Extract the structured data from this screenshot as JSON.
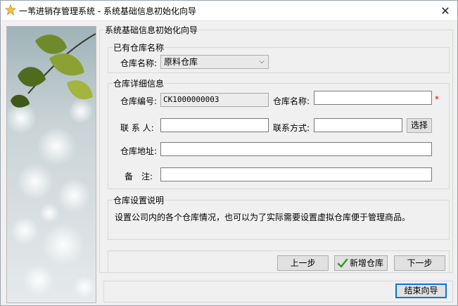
{
  "window": {
    "title": "一苇进销存管理系统 - 系统基础信息初始化向导",
    "close_glyph": "✕",
    "icon": "star-icon"
  },
  "wizard": {
    "title": "系统基础信息初始化向导",
    "existing_group": {
      "title": "已有仓库名称",
      "label": "仓库名称:",
      "selected": "原料仓库",
      "chevron": "⌵"
    },
    "detail_group": {
      "title": "仓库详细信息",
      "code_label": "仓库编号:",
      "code_value": "CK1000000003",
      "name_label": "仓库名称:",
      "name_value": "",
      "required_mark": "*",
      "contact_label": "联 系 人:",
      "contact_value": "",
      "phone_label": "联系方式:",
      "phone_value": "",
      "choose_button": "选择",
      "address_label": "仓库地址:",
      "address_value": "",
      "remark_label": "备　注:",
      "remark_value": ""
    },
    "info_group": {
      "title": "仓库设置说明",
      "text": "设置公司内的各个仓库情况，也可以为了实际需要设置虚拟仓库便于管理商品。"
    },
    "buttons": {
      "prev": "上一步",
      "add": "新增仓库",
      "next": "下一步",
      "finish": "结束向导"
    }
  },
  "colors": {
    "window_bg": "#f0f0f0",
    "required": "#e00000",
    "check_green": "#2e9e2e"
  }
}
